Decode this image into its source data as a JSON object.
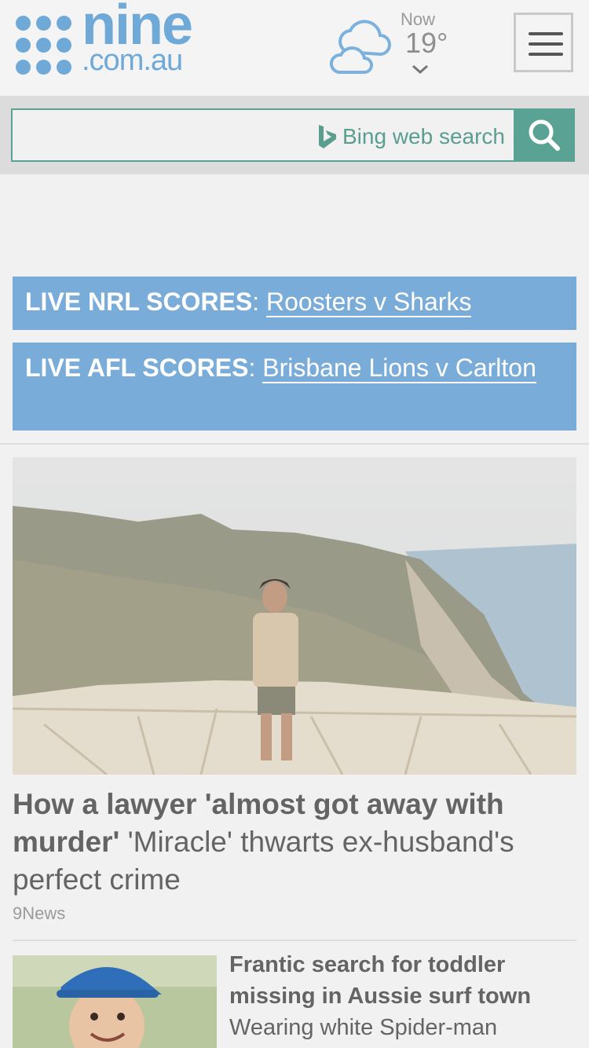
{
  "header": {
    "logo": {
      "word": "nine",
      "domain": ".com.au"
    },
    "weather": {
      "icon": "cloud-icon",
      "label": "Now",
      "temperature": "19°"
    },
    "menu_icon": "hamburger-icon"
  },
  "search": {
    "placeholder": "Bing web search",
    "provider_icon": "bing-logo-icon",
    "button_icon": "search-icon"
  },
  "scores": [
    {
      "label": "LIVE NRL SCORES",
      "separator": ":",
      "link": "Roosters v Sharks"
    },
    {
      "label": "LIVE AFL SCORES",
      "separator": ":",
      "link": "Brisbane Lions v Carlton"
    }
  ],
  "stories": [
    {
      "headline": "How a lawyer 'almost got away with murder'",
      "summary": "'Miracle' thwarts ex-husband's perfect crime",
      "source": "9News",
      "image": "woman-on-coastal-lookout-photo"
    },
    {
      "headline": "Frantic search for toddler missing in Aussie surf town",
      "summary": "Wearing white Spider-man",
      "image": "toddler-in-blue-cap-photo"
    }
  ],
  "colors": {
    "brand": "#6fa9d8",
    "score_banner": "#79acd8",
    "search_accent": "#5aa394",
    "background": "#f1f1f1"
  }
}
